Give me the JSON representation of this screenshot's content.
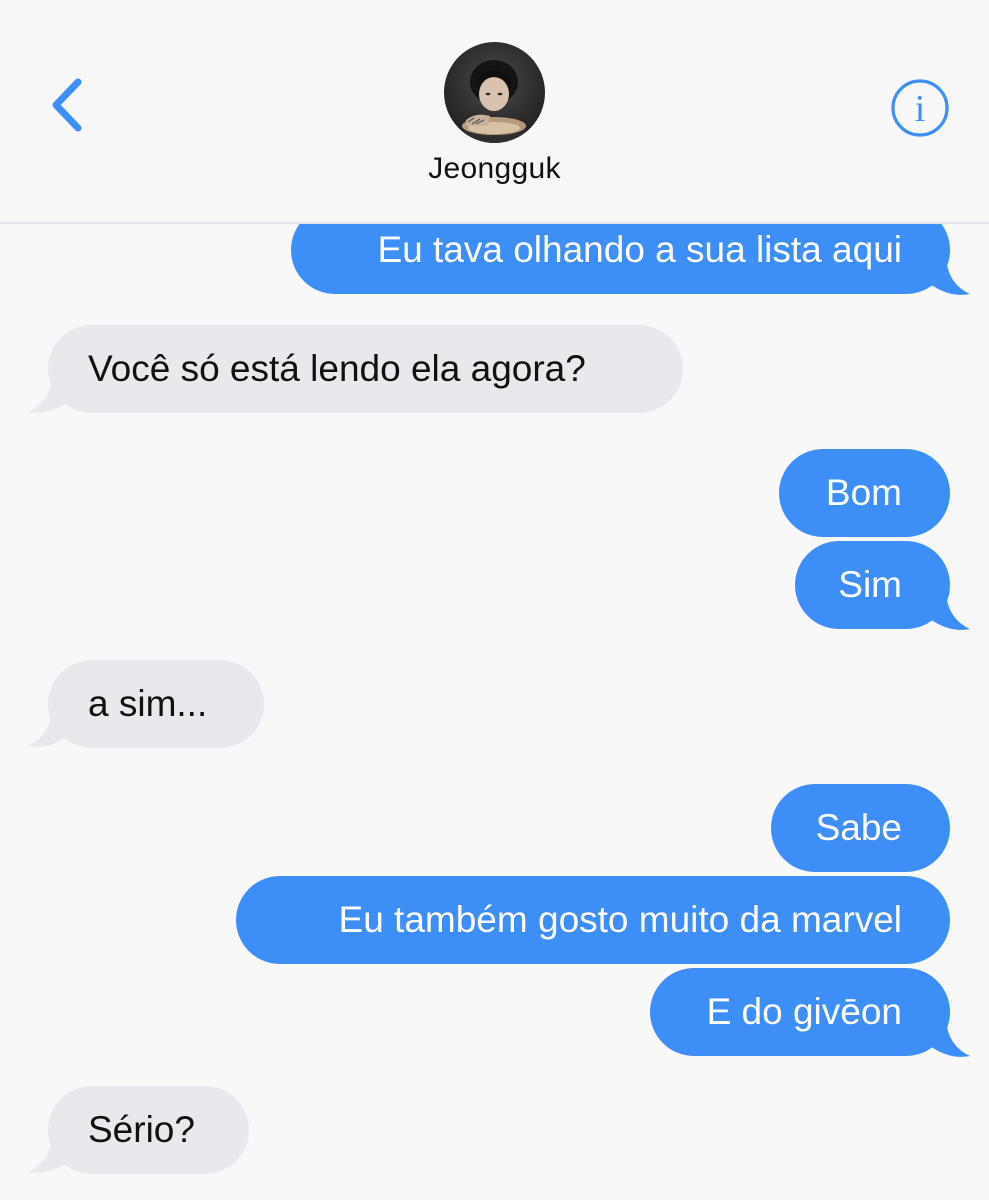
{
  "header": {
    "contact_name": "Jeongguk",
    "back_icon": "chevron-left-icon",
    "info_icon": "info-circle-icon"
  },
  "colors": {
    "accent": "#3d8ef7",
    "incoming_bubble": "#e8e8ed",
    "background": "#f8f8f9"
  },
  "messages": [
    {
      "direction": "outgoing",
      "text": "Eu tava olhando a sua lista aqui"
    },
    {
      "direction": "incoming",
      "text": "Você só está lendo ela agora?"
    },
    {
      "direction": "outgoing",
      "text": "Bom"
    },
    {
      "direction": "outgoing",
      "text": "Sim"
    },
    {
      "direction": "incoming",
      "text": "a sim..."
    },
    {
      "direction": "outgoing",
      "text": "Sabe"
    },
    {
      "direction": "outgoing",
      "text": "Eu também gosto muito da marvel"
    },
    {
      "direction": "outgoing",
      "text": "E do givēon"
    },
    {
      "direction": "incoming",
      "text": "Sério?"
    }
  ]
}
